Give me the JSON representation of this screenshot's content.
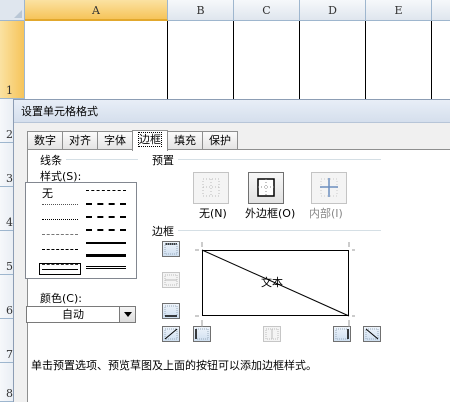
{
  "spreadsheet": {
    "columns": [
      "A",
      "B",
      "C",
      "D",
      "E"
    ],
    "rows": [
      "1",
      "2",
      "3",
      "4",
      "5",
      "6",
      "7",
      "8"
    ]
  },
  "dialog": {
    "title": "设置单元格格式",
    "tabs": [
      "数字",
      "对齐",
      "字体",
      "边框",
      "填充",
      "保护"
    ],
    "active_tab": "边框",
    "line_group": {
      "title": "线条",
      "style_label": "样式(S):",
      "none_label": "无",
      "color_label": "颜色(C):",
      "color_value": "自动"
    },
    "presets": {
      "title": "预置",
      "items": [
        "无(N)",
        "外边框(O)",
        "内部(I)"
      ]
    },
    "border": {
      "title": "边框",
      "preview_text": "文本"
    },
    "hint": "单击预置选项、预览草图及上面的按钮可以添加边框样式。"
  },
  "colors": {
    "accent": "#f6c45a",
    "dialog_bg": "#f0f0f0",
    "header_bg": "#dfe6ee",
    "button_blue": "#cfdff0"
  }
}
